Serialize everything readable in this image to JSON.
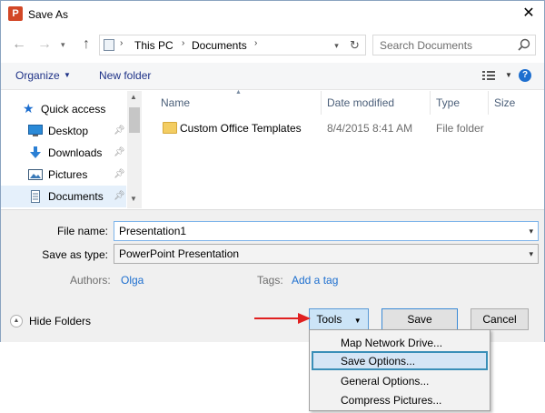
{
  "window": {
    "title": "Save As",
    "app_icon_letter": "P",
    "close_glyph": "✕"
  },
  "address": {
    "crumbs": [
      "This PC",
      "Documents"
    ],
    "search_placeholder": "Search Documents"
  },
  "toolbar": {
    "organize_label": "Organize",
    "new_folder_label": "New folder"
  },
  "nav": {
    "items": [
      {
        "label": "Quick access",
        "icon": "star-icon"
      },
      {
        "label": "Desktop",
        "icon": "desktop-icon"
      },
      {
        "label": "Downloads",
        "icon": "download-icon"
      },
      {
        "label": "Pictures",
        "icon": "pictures-icon"
      },
      {
        "label": "Documents",
        "icon": "documents-icon"
      }
    ]
  },
  "filelist": {
    "columns": [
      "Name",
      "Date modified",
      "Type",
      "Size"
    ],
    "rows": [
      {
        "name": "Custom Office Templates",
        "date": "8/4/2015 8:41 AM",
        "type": "File folder",
        "size": ""
      }
    ]
  },
  "form": {
    "file_name_label": "File name:",
    "file_name_value": "Presentation1",
    "save_type_label": "Save as type:",
    "save_type_value": "PowerPoint Presentation",
    "authors_label": "Authors:",
    "authors_value": "Olga",
    "tags_label": "Tags:",
    "tags_value": "Add a tag",
    "hide_folders_label": "Hide Folders"
  },
  "buttons": {
    "tools_label": "Tools",
    "save_label": "Save",
    "cancel_label": "Cancel"
  },
  "tools_menu": {
    "items": [
      "Map Network Drive...",
      "Save Options...",
      "General Options...",
      "Compress Pictures..."
    ],
    "highlighted": "Save Options..."
  },
  "colors": {
    "accent": "#1e6fcf",
    "annotation_arrow": "#e02020",
    "menu_highlight_border": "#3a8fb8"
  }
}
